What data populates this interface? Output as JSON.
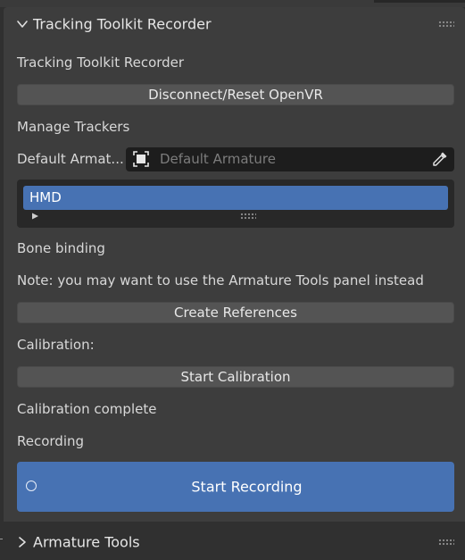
{
  "panel": {
    "title": "Tracking Toolkit Recorder",
    "section_title": "Tracking Toolkit Recorder",
    "disconnect_label": "Disconnect/Reset OpenVR",
    "manage_trackers_label": "Manage Trackers",
    "default_armature": {
      "label": "Default Armat...",
      "placeholder": "Default Armature",
      "value": ""
    },
    "trackers": {
      "items": [
        {
          "label": "HMD",
          "selected": true
        }
      ]
    },
    "bone_binding_label": "Bone binding",
    "note_text": "Note: you may want to use the Armature Tools panel instead",
    "create_references_label": "Create References",
    "calibration_label": "Calibration:",
    "start_calibration_label": "Start Calibration",
    "calibration_status": "Calibration complete",
    "recording_label": "Recording",
    "start_recording_label": "Start Recording"
  },
  "subpanel": {
    "title": "Armature Tools"
  },
  "colors": {
    "background": "#303030",
    "panel": "#3d3d3d",
    "button": "#545454",
    "accent": "#4772b3",
    "field": "#1d1d1d"
  },
  "icons": {
    "collapse": "chevron-down-icon",
    "expand": "chevron-right-icon",
    "drag": "drag-handle-icon",
    "armature": "armature-object-icon",
    "eyedropper": "eyedropper-icon",
    "record": "record-circle-icon"
  }
}
